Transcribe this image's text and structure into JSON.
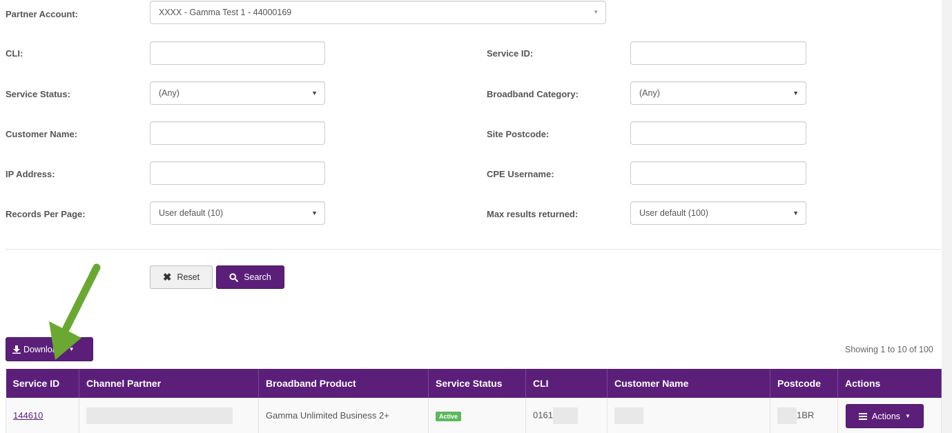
{
  "form": {
    "partner_account": {
      "label": "Partner Account:",
      "value": "XXXX - Gamma Test 1 - 44000169"
    },
    "cli": {
      "label": "CLI:",
      "value": ""
    },
    "service_id": {
      "label": "Service ID:",
      "value": ""
    },
    "service_status": {
      "label": "Service Status:",
      "value": "(Any)"
    },
    "broadband_category": {
      "label": "Broadband Category:",
      "value": "(Any)"
    },
    "customer_name": {
      "label": "Customer Name:",
      "value": ""
    },
    "site_postcode": {
      "label": "Site Postcode:",
      "value": ""
    },
    "ip_address": {
      "label": "IP Address:",
      "value": ""
    },
    "cpe_username": {
      "label": "CPE Username:",
      "value": ""
    },
    "records_per_page": {
      "label": "Records Per Page:",
      "value": "User default (10)"
    },
    "max_results": {
      "label": "Max results returned:",
      "value": "User default (100)"
    }
  },
  "buttons": {
    "reset": "Reset",
    "search": "Search",
    "download": "Download",
    "actions": "Actions"
  },
  "showing_text": "Showing 1 to 10 of 100",
  "table": {
    "columns": [
      "Service ID",
      "Channel Partner",
      "Broadband Product",
      "Service Status",
      "CLI",
      "Customer Name",
      "Postcode",
      "Actions"
    ],
    "rows": [
      {
        "service_id": "144610",
        "channel_partner": "",
        "broadband_product": "Gamma Unlimited Business 2+",
        "service_status": "Active",
        "cli": "0161",
        "customer_name": "",
        "postcode": "1BR"
      }
    ]
  },
  "colors": {
    "brand": "#5b1f7a",
    "status_active": "#5cb85c",
    "annotation_arrow": "#6aa832"
  },
  "icons": {
    "reset": "close-x-icon",
    "search": "magnifier-icon",
    "download": "download-icon",
    "actions": "hamburger-icon",
    "dropdown": "caret-down-icon"
  }
}
